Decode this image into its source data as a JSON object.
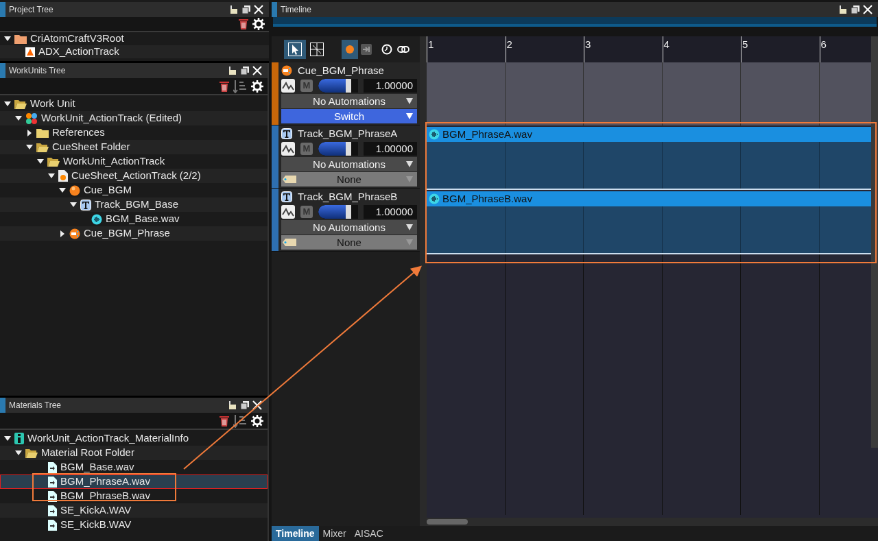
{
  "project_tree": {
    "title": "Project Tree",
    "items": [
      {
        "label": "CriAtomCraftV3Root",
        "kind": "root-folder",
        "expanded": true,
        "children": [
          {
            "label": "ADX_ActionTrack",
            "kind": "project"
          }
        ]
      }
    ]
  },
  "workunits_tree": {
    "title": "WorkUnits Tree",
    "items": [
      {
        "label": "Work Unit",
        "kind": "folder-open",
        "expanded": true,
        "children": [
          {
            "label": "WorkUnit_ActionTrack (Edited)",
            "kind": "workunit",
            "expanded": true,
            "children": [
              {
                "label": "References",
                "kind": "folder",
                "expanded": false
              },
              {
                "label": "CueSheet Folder",
                "kind": "folder-open",
                "expanded": true,
                "children": [
                  {
                    "label": "WorkUnit_ActionTrack",
                    "kind": "folder-open",
                    "expanded": true,
                    "children": [
                      {
                        "label": "CueSheet_ActionTrack (2/2)",
                        "kind": "cuesheet",
                        "expanded": true,
                        "children": [
                          {
                            "label": "Cue_BGM",
                            "kind": "cue",
                            "expanded": true,
                            "children": [
                              {
                                "label": "Track_BGM_Base",
                                "kind": "track",
                                "expanded": true,
                                "children": [
                                  {
                                    "label": "BGM_Base.wav",
                                    "kind": "wave"
                                  }
                                ]
                              }
                            ]
                          },
                          {
                            "label": "Cue_BGM_Phrase",
                            "kind": "switch-cue",
                            "expanded": false
                          }
                        ]
                      }
                    ]
                  }
                ]
              }
            ]
          }
        ]
      }
    ]
  },
  "materials_tree": {
    "title": "Materials Tree",
    "items": [
      {
        "label": "WorkUnit_ActionTrack_MaterialInfo",
        "kind": "material-info",
        "expanded": true,
        "selected": false,
        "children": [
          {
            "label": "Material Root Folder",
            "kind": "folder-open",
            "expanded": true,
            "selected": false,
            "children": [
              {
                "label": "BGM_Base.wav",
                "kind": "file",
                "selected": false
              },
              {
                "label": "BGM_PhraseA.wav",
                "kind": "file",
                "selected": true
              },
              {
                "label": "BGM_PhraseB.wav",
                "kind": "file",
                "selected": false
              },
              {
                "label": "SE_KickA.WAV",
                "kind": "file",
                "selected": false
              },
              {
                "label": "SE_KickB.WAV",
                "kind": "file",
                "selected": false
              }
            ]
          }
        ]
      }
    ]
  },
  "timeline": {
    "title": "Timeline",
    "tools": [
      {
        "kind": "pointer",
        "selected": true
      },
      {
        "kind": "split",
        "selected": false
      },
      {
        "kind": "record",
        "selected": true
      },
      {
        "kind": "jump",
        "selected": false
      },
      {
        "kind": "clock",
        "selected": false
      },
      {
        "kind": "link",
        "selected": false
      }
    ],
    "tracks": [
      {
        "kind": "switch-cue",
        "name": "Cue_BGM_Phrase",
        "mute_label": "M",
        "color": "#c8670a",
        "level": 0.83,
        "value": "1.00000",
        "automation": "No Automations",
        "selector": {
          "kind": "switch",
          "label": "Switch"
        }
      },
      {
        "kind": "track",
        "name": "Track_BGM_PhraseA",
        "mute_label": "M",
        "color": "#2e6fb0",
        "level": 0.83,
        "value": "1.00000",
        "automation": "No Automations",
        "selector": {
          "kind": "none",
          "label": "None"
        }
      },
      {
        "kind": "track",
        "name": "Track_BGM_PhraseB",
        "mute_label": "M",
        "color": "#2e6fb0",
        "level": 0.83,
        "value": "1.00000",
        "automation": "No Automations",
        "selector": {
          "kind": "none",
          "label": "None"
        }
      }
    ],
    "ruler": [
      "1",
      "2",
      "3",
      "4",
      "5",
      "6"
    ],
    "clips": [
      {
        "label": "BGM_PhraseA.wav"
      },
      {
        "label": "BGM_PhraseB.wav"
      }
    ]
  },
  "bottom_tabs": [
    {
      "label": "Timeline",
      "selected": true
    },
    {
      "label": "Mixer",
      "selected": false
    },
    {
      "label": "AISAC",
      "selected": false
    }
  ]
}
